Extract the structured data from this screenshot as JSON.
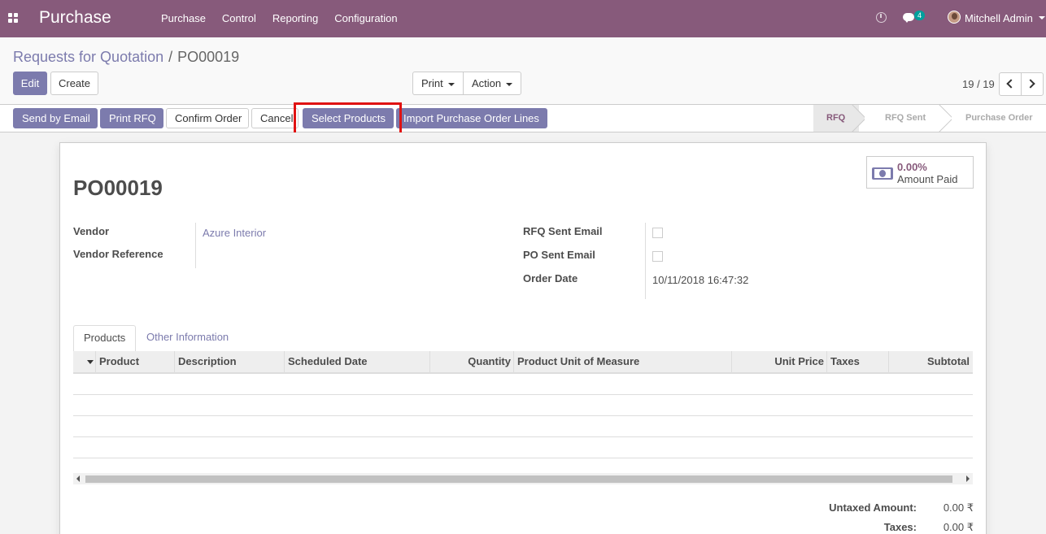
{
  "navbar": {
    "brand": "Purchase",
    "menu": [
      "Purchase",
      "Control",
      "Reporting",
      "Configuration"
    ],
    "chat_count": "4",
    "user_name": "Mitchell Admin",
    "color": "#875a7b"
  },
  "breadcrumb": {
    "parent": "Requests for Quotation",
    "separator": "/",
    "current": "PO00019"
  },
  "control": {
    "edit": "Edit",
    "create": "Create",
    "print": "Print",
    "action": "Action",
    "pager": "19 / 19"
  },
  "statusbar": {
    "buttons": {
      "send_email": "Send by Email",
      "print_rfq": "Print RFQ",
      "confirm": "Confirm Order",
      "cancel": "Cancel",
      "select_products": "Select Products",
      "import_lines": "Import Purchase Order Lines"
    },
    "stages": {
      "rfq": "RFQ",
      "rfq_sent": "RFQ Sent",
      "purchase_order": "Purchase Order"
    },
    "active_stage": "RFQ"
  },
  "form": {
    "title": "PO00019",
    "amount_paid": {
      "value": "0.00%",
      "label": "Amount Paid"
    },
    "fields": {
      "vendor_label": "Vendor",
      "vendor_value": "Azure Interior",
      "vendor_ref_label": "Vendor Reference",
      "rfq_sent_email_label": "RFQ Sent Email",
      "po_sent_email_label": "PO Sent Email",
      "order_date_label": "Order Date",
      "order_date_value": "10/11/2018 16:47:32"
    },
    "tabs": {
      "products": "Products",
      "other": "Other Information"
    },
    "columns": {
      "product": "Product",
      "description": "Description",
      "scheduled_date": "Scheduled Date",
      "quantity": "Quantity",
      "uom": "Product Unit of Measure",
      "unit_price": "Unit Price",
      "taxes": "Taxes",
      "subtotal": "Subtotal"
    },
    "totals": {
      "untaxed_label": "Untaxed Amount:",
      "untaxed_value": "0.00 ₹",
      "taxes_label": "Taxes:",
      "taxes_value": "0.00 ₹"
    }
  },
  "colors": {
    "primary": "#7c7bad",
    "highlight": "#e01212"
  }
}
